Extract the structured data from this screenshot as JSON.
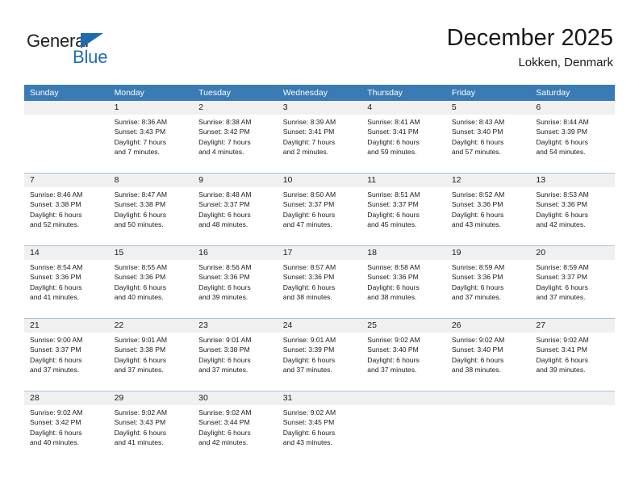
{
  "brand": {
    "name_dark": "General",
    "name_blue": "Blue",
    "accent_color": "#1b6cb0"
  },
  "header": {
    "title": "December 2025",
    "location": "Lokken, Denmark"
  },
  "calendar": {
    "header_color": "#3a7ab5",
    "daynum_band_color": "#f0f0f0",
    "day_names": [
      "Sunday",
      "Monday",
      "Tuesday",
      "Wednesday",
      "Thursday",
      "Friday",
      "Saturday"
    ],
    "weeks": [
      [
        {
          "day": "",
          "lines": []
        },
        {
          "day": "1",
          "lines": [
            "Sunrise: 8:36 AM",
            "Sunset: 3:43 PM",
            "Daylight: 7 hours",
            "and 7 minutes."
          ]
        },
        {
          "day": "2",
          "lines": [
            "Sunrise: 8:38 AM",
            "Sunset: 3:42 PM",
            "Daylight: 7 hours",
            "and 4 minutes."
          ]
        },
        {
          "day": "3",
          "lines": [
            "Sunrise: 8:39 AM",
            "Sunset: 3:41 PM",
            "Daylight: 7 hours",
            "and 2 minutes."
          ]
        },
        {
          "day": "4",
          "lines": [
            "Sunrise: 8:41 AM",
            "Sunset: 3:41 PM",
            "Daylight: 6 hours",
            "and 59 minutes."
          ]
        },
        {
          "day": "5",
          "lines": [
            "Sunrise: 8:43 AM",
            "Sunset: 3:40 PM",
            "Daylight: 6 hours",
            "and 57 minutes."
          ]
        },
        {
          "day": "6",
          "lines": [
            "Sunrise: 8:44 AM",
            "Sunset: 3:39 PM",
            "Daylight: 6 hours",
            "and 54 minutes."
          ]
        }
      ],
      [
        {
          "day": "7",
          "lines": [
            "Sunrise: 8:46 AM",
            "Sunset: 3:38 PM",
            "Daylight: 6 hours",
            "and 52 minutes."
          ]
        },
        {
          "day": "8",
          "lines": [
            "Sunrise: 8:47 AM",
            "Sunset: 3:38 PM",
            "Daylight: 6 hours",
            "and 50 minutes."
          ]
        },
        {
          "day": "9",
          "lines": [
            "Sunrise: 8:48 AM",
            "Sunset: 3:37 PM",
            "Daylight: 6 hours",
            "and 48 minutes."
          ]
        },
        {
          "day": "10",
          "lines": [
            "Sunrise: 8:50 AM",
            "Sunset: 3:37 PM",
            "Daylight: 6 hours",
            "and 47 minutes."
          ]
        },
        {
          "day": "11",
          "lines": [
            "Sunrise: 8:51 AM",
            "Sunset: 3:37 PM",
            "Daylight: 6 hours",
            "and 45 minutes."
          ]
        },
        {
          "day": "12",
          "lines": [
            "Sunrise: 8:52 AM",
            "Sunset: 3:36 PM",
            "Daylight: 6 hours",
            "and 43 minutes."
          ]
        },
        {
          "day": "13",
          "lines": [
            "Sunrise: 8:53 AM",
            "Sunset: 3:36 PM",
            "Daylight: 6 hours",
            "and 42 minutes."
          ]
        }
      ],
      [
        {
          "day": "14",
          "lines": [
            "Sunrise: 8:54 AM",
            "Sunset: 3:36 PM",
            "Daylight: 6 hours",
            "and 41 minutes."
          ]
        },
        {
          "day": "15",
          "lines": [
            "Sunrise: 8:55 AM",
            "Sunset: 3:36 PM",
            "Daylight: 6 hours",
            "and 40 minutes."
          ]
        },
        {
          "day": "16",
          "lines": [
            "Sunrise: 8:56 AM",
            "Sunset: 3:36 PM",
            "Daylight: 6 hours",
            "and 39 minutes."
          ]
        },
        {
          "day": "17",
          "lines": [
            "Sunrise: 8:57 AM",
            "Sunset: 3:36 PM",
            "Daylight: 6 hours",
            "and 38 minutes."
          ]
        },
        {
          "day": "18",
          "lines": [
            "Sunrise: 8:58 AM",
            "Sunset: 3:36 PM",
            "Daylight: 6 hours",
            "and 38 minutes."
          ]
        },
        {
          "day": "19",
          "lines": [
            "Sunrise: 8:59 AM",
            "Sunset: 3:36 PM",
            "Daylight: 6 hours",
            "and 37 minutes."
          ]
        },
        {
          "day": "20",
          "lines": [
            "Sunrise: 8:59 AM",
            "Sunset: 3:37 PM",
            "Daylight: 6 hours",
            "and 37 minutes."
          ]
        }
      ],
      [
        {
          "day": "21",
          "lines": [
            "Sunrise: 9:00 AM",
            "Sunset: 3:37 PM",
            "Daylight: 6 hours",
            "and 37 minutes."
          ]
        },
        {
          "day": "22",
          "lines": [
            "Sunrise: 9:01 AM",
            "Sunset: 3:38 PM",
            "Daylight: 6 hours",
            "and 37 minutes."
          ]
        },
        {
          "day": "23",
          "lines": [
            "Sunrise: 9:01 AM",
            "Sunset: 3:38 PM",
            "Daylight: 6 hours",
            "and 37 minutes."
          ]
        },
        {
          "day": "24",
          "lines": [
            "Sunrise: 9:01 AM",
            "Sunset: 3:39 PM",
            "Daylight: 6 hours",
            "and 37 minutes."
          ]
        },
        {
          "day": "25",
          "lines": [
            "Sunrise: 9:02 AM",
            "Sunset: 3:40 PM",
            "Daylight: 6 hours",
            "and 37 minutes."
          ]
        },
        {
          "day": "26",
          "lines": [
            "Sunrise: 9:02 AM",
            "Sunset: 3:40 PM",
            "Daylight: 6 hours",
            "and 38 minutes."
          ]
        },
        {
          "day": "27",
          "lines": [
            "Sunrise: 9:02 AM",
            "Sunset: 3:41 PM",
            "Daylight: 6 hours",
            "and 39 minutes."
          ]
        }
      ],
      [
        {
          "day": "28",
          "lines": [
            "Sunrise: 9:02 AM",
            "Sunset: 3:42 PM",
            "Daylight: 6 hours",
            "and 40 minutes."
          ]
        },
        {
          "day": "29",
          "lines": [
            "Sunrise: 9:02 AM",
            "Sunset: 3:43 PM",
            "Daylight: 6 hours",
            "and 41 minutes."
          ]
        },
        {
          "day": "30",
          "lines": [
            "Sunrise: 9:02 AM",
            "Sunset: 3:44 PM",
            "Daylight: 6 hours",
            "and 42 minutes."
          ]
        },
        {
          "day": "31",
          "lines": [
            "Sunrise: 9:02 AM",
            "Sunset: 3:45 PM",
            "Daylight: 6 hours",
            "and 43 minutes."
          ]
        },
        {
          "day": "",
          "lines": []
        },
        {
          "day": "",
          "lines": []
        },
        {
          "day": "",
          "lines": []
        }
      ]
    ]
  }
}
